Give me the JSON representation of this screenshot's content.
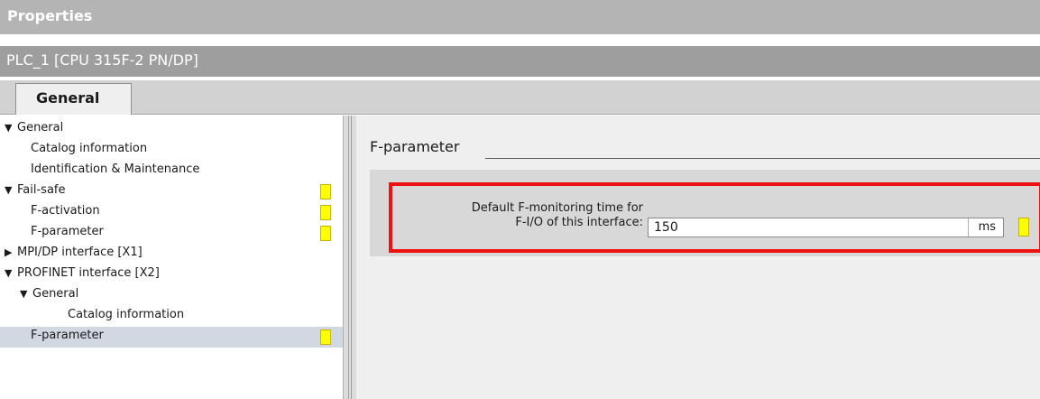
{
  "window": {
    "title": "Properties"
  },
  "object": {
    "name": "PLC_1 [CPU 315F-2 PN/DP]"
  },
  "tabs": [
    {
      "label": "General"
    }
  ],
  "nav": {
    "items": [
      {
        "label": "General",
        "level": 0,
        "expand": "expanded",
        "marker": false,
        "selected": false
      },
      {
        "label": "Catalog information",
        "level": 1,
        "expand": "none",
        "marker": false,
        "selected": false
      },
      {
        "label": "Identification & Maintenance",
        "level": 1,
        "expand": "none",
        "marker": false,
        "selected": false
      },
      {
        "label": "Fail-safe",
        "level": 0,
        "expand": "expanded",
        "marker": true,
        "selected": false
      },
      {
        "label": "F-activation",
        "level": 1,
        "expand": "none",
        "marker": true,
        "selected": false
      },
      {
        "label": "F-parameter",
        "level": 1,
        "expand": "none",
        "marker": true,
        "selected": false
      },
      {
        "label": "MPI/DP interface [X1]",
        "level": 0,
        "expand": "collapsed",
        "marker": false,
        "selected": false
      },
      {
        "label": "PROFINET interface [X2]",
        "level": 0,
        "expand": "expanded",
        "marker": false,
        "selected": false
      },
      {
        "label": "General",
        "level": 1,
        "expand": "expanded",
        "marker": false,
        "selected": false
      },
      {
        "label": "Catalog information",
        "level": 2,
        "expand": "none",
        "marker": false,
        "selected": false
      },
      {
        "label": "F-parameter",
        "level": 1,
        "expand": "none",
        "marker": true,
        "selected": true
      }
    ]
  },
  "content": {
    "section_title": "F-parameter",
    "field_label_line1": "Default F-monitoring time for",
    "field_label_line2": "F-I/O of this interface:",
    "field_value": "150",
    "field_unit": "ms"
  },
  "icons": {
    "expanded": "triangle-down-icon",
    "collapsed": "triangle-right-icon",
    "marker": "yellow-status-marker"
  },
  "colors": {
    "marker": "#ffff00",
    "highlight": "#ee1111",
    "titlebar": "#b4b4b4",
    "selected_row": "#d2d8e2"
  }
}
